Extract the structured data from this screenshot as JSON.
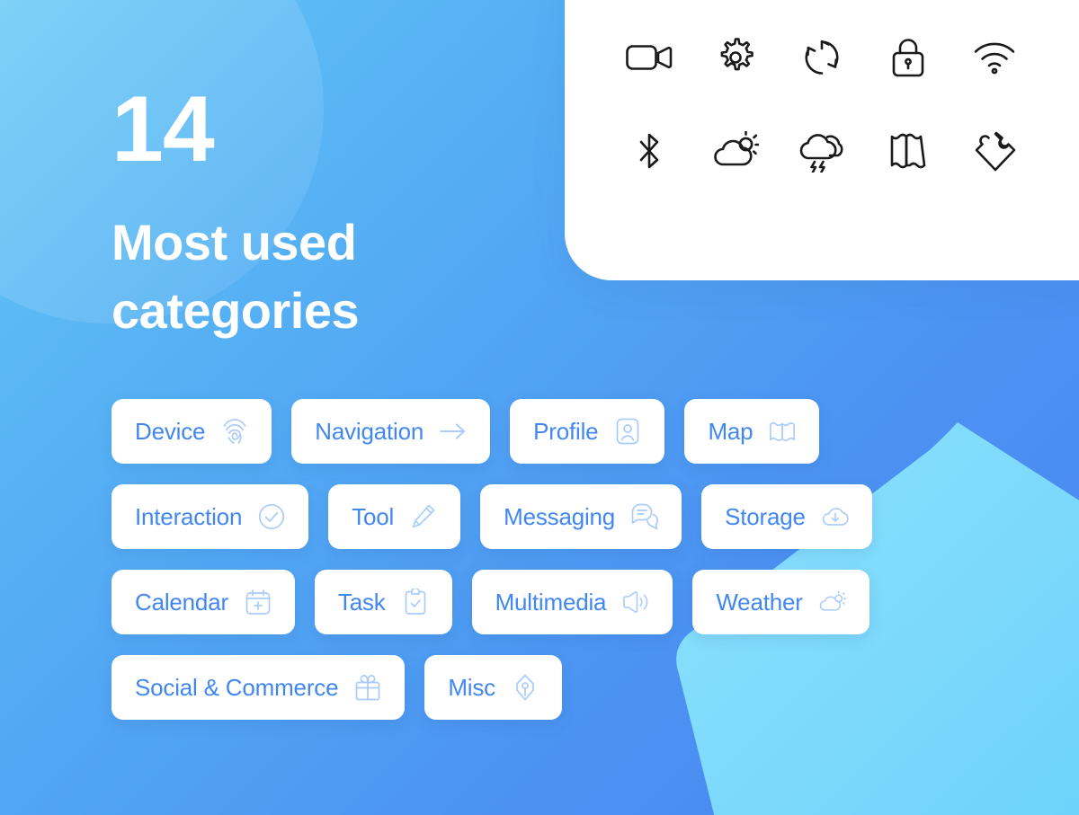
{
  "poster": {
    "count": "14",
    "title_line_1": "Most used",
    "title_line_2": "categories",
    "background_gradient_from": "#62C7F5",
    "background_gradient_to": "#4B86F0",
    "chip_text_color": "#4187F2",
    "chip_icon_color": "#A9CCFA",
    "card_icon_color": "#1A1A1A",
    "blob_color": "#7BDBFB"
  },
  "showcase_icons": [
    {
      "name": "video-camera-icon",
      "label": "Video camera"
    },
    {
      "name": "gear-icon",
      "label": "Settings gear"
    },
    {
      "name": "sync-icon",
      "label": "Sync refresh"
    },
    {
      "name": "lock-icon",
      "label": "Lock"
    },
    {
      "name": "wifi-icon",
      "label": "Wi-Fi"
    },
    {
      "name": "bluetooth-icon",
      "label": "Bluetooth"
    },
    {
      "name": "partly-cloudy-icon",
      "label": "Partly cloudy"
    },
    {
      "name": "thunderstorm-icon",
      "label": "Thunderstorm"
    },
    {
      "name": "folded-map-icon",
      "label": "Folded map"
    },
    {
      "name": "puzzle-piece-icon",
      "label": "Puzzle piece"
    }
  ],
  "categories": [
    [
      {
        "label": "Device",
        "icon": "fingerprint-icon"
      },
      {
        "label": "Navigation",
        "icon": "arrow-right-icon"
      },
      {
        "label": "Profile",
        "icon": "user-card-icon"
      },
      {
        "label": "Map",
        "icon": "folded-map-icon"
      }
    ],
    [
      {
        "label": "Interaction",
        "icon": "check-circle-icon"
      },
      {
        "label": "Tool",
        "icon": "pencil-icon"
      },
      {
        "label": "Messaging",
        "icon": "chat-bubbles-icon"
      },
      {
        "label": "Storage",
        "icon": "cloud-download-icon"
      }
    ],
    [
      {
        "label": "Calendar",
        "icon": "calendar-plus-icon"
      },
      {
        "label": "Task",
        "icon": "clipboard-check-icon"
      },
      {
        "label": "Multimedia",
        "icon": "speaker-volume-icon"
      },
      {
        "label": "Weather",
        "icon": "partly-cloudy-icon"
      }
    ],
    [
      {
        "label": "Social & Commerce",
        "icon": "gift-icon"
      },
      {
        "label": "Misc",
        "icon": "pen-nib-icon"
      }
    ]
  ]
}
